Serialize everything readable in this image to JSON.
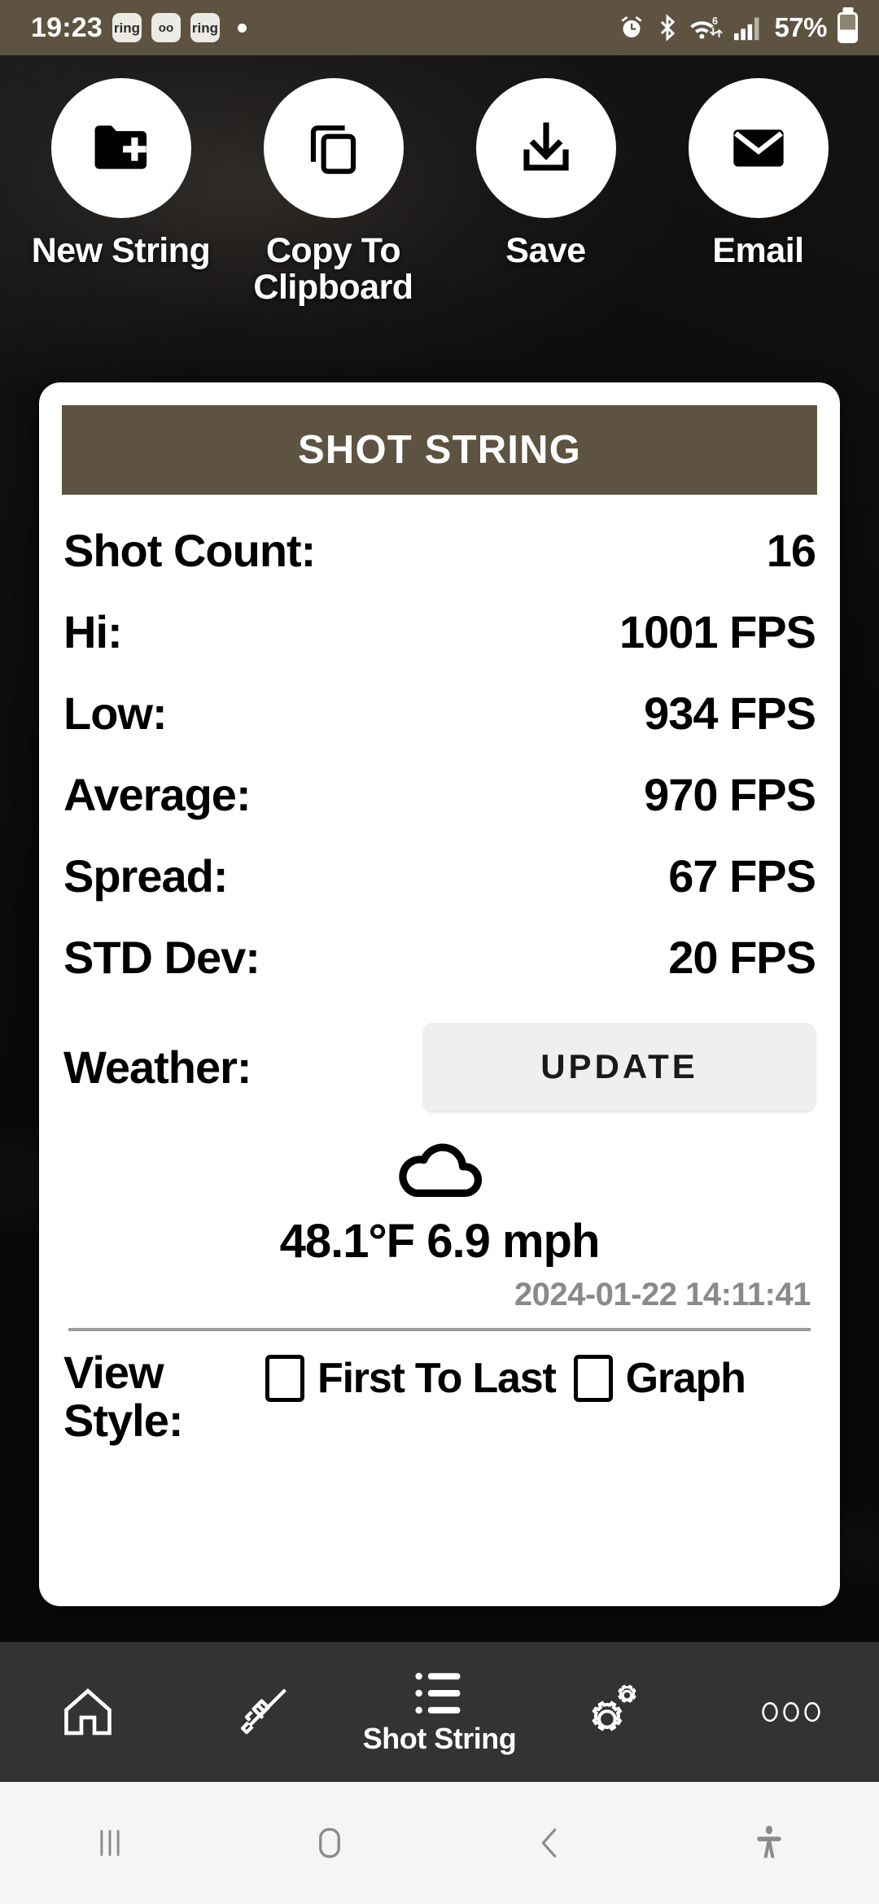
{
  "status_bar": {
    "time": "19:23",
    "chips": [
      {
        "name": "ring-app-badge",
        "label": "ring"
      },
      {
        "name": "voicemail-badge",
        "label": "oo"
      },
      {
        "name": "ring-app-badge-2",
        "label": "ring"
      }
    ],
    "notification_dot": "•",
    "icons": [
      "alarm-icon",
      "bluetooth-icon",
      "wifi-6-icon",
      "signal-bars-icon"
    ],
    "battery_percent": "57%",
    "battery_level": 42,
    "background_color": "#5d5340"
  },
  "actions": [
    {
      "id": "new-string",
      "label": "New String",
      "icon": "folder-plus-icon"
    },
    {
      "id": "copy-to-clipboard",
      "label": "Copy To Clipboard",
      "icon": "copy-icon"
    },
    {
      "id": "save",
      "label": "Save",
      "icon": "download-icon"
    },
    {
      "id": "email",
      "label": "Email",
      "icon": "envelope-icon"
    }
  ],
  "card": {
    "title": "SHOT STRING",
    "accent_color": "#5d5340",
    "stats": [
      {
        "key": "Shot Count:",
        "value": "16"
      },
      {
        "key": "Hi:",
        "value": "1001 FPS"
      },
      {
        "key": "Low:",
        "value": "934 FPS"
      },
      {
        "key": "Average:",
        "value": "970 FPS"
      },
      {
        "key": "Spread:",
        "value": "67 FPS"
      },
      {
        "key": "STD Dev:",
        "value": "20 FPS"
      }
    ],
    "weather": {
      "label": "Weather:",
      "update_button": "UPDATE",
      "icon": "cloud-icon",
      "conditions": "48.1°F 6.9 mph",
      "temperature": "48.1°F",
      "wind": "6.9 mph",
      "timestamp": "2024-01-22 14:11:41"
    },
    "view_style": {
      "label": "View Style:",
      "options": [
        {
          "label": "First To Last",
          "checked": false
        },
        {
          "label": "Graph",
          "checked": false
        }
      ]
    }
  },
  "app_nav": [
    {
      "id": "home",
      "icon": "home-icon",
      "label": "",
      "active": false
    },
    {
      "id": "rifle",
      "icon": "rifle-icon",
      "label": "",
      "active": false
    },
    {
      "id": "shot-string",
      "icon": "list-icon",
      "label": "Shot String",
      "active": true
    },
    {
      "id": "settings",
      "icon": "gears-icon",
      "label": "",
      "active": false
    },
    {
      "id": "more",
      "icon": "more-dots-icon",
      "label": "",
      "active": false
    }
  ],
  "system_nav": [
    {
      "id": "recents",
      "icon": "recents-icon"
    },
    {
      "id": "home",
      "icon": "home-square-icon"
    },
    {
      "id": "back",
      "icon": "back-chevron-icon"
    },
    {
      "id": "accessibility",
      "icon": "accessibility-icon"
    }
  ]
}
